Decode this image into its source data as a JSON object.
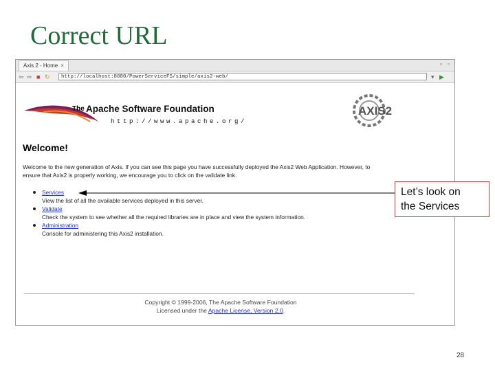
{
  "slide": {
    "title": "Correct URL",
    "page_number": "28"
  },
  "browser": {
    "tab_label": "Axis 2 - Home",
    "tab_close": "×",
    "url": "http://localhost:8080/PowerServiceFS/simple/axis2-web/",
    "icons": [
      "back-icon",
      "forward-icon",
      "stop-icon",
      "refresh-icon",
      "go-icon",
      "nav-icon"
    ]
  },
  "page": {
    "apache_the": "The",
    "apache_name": "Apache Software Foundation",
    "apache_url": "http://www.apache.org/",
    "axis_logo_text": "AXIS2",
    "welcome_heading": "Welcome!",
    "intro_line1": "Welcome to the new generation of Axis. If you can see this page you have successfully deployed the Axis2 Web Application. However, to",
    "intro_line2": "ensure that Axis2 is properly working, we encourage you to click on the validate link.",
    "links": [
      {
        "label": "Services",
        "desc": "View the list of all the available services deployed in this server."
      },
      {
        "label": "Validate",
        "desc": "Check the system to see whether all the required libraries are in place and view the system information."
      },
      {
        "label": "Administration",
        "desc": "Console for administering this Axis2 installation."
      }
    ],
    "footer_line1": "Copyright © 1999-2006, The Apache Software Foundation",
    "footer_line2_prefix": "Licensed under the ",
    "footer_license_link": "Apache License, Version 2.0",
    "footer_line2_suffix": "."
  },
  "callout": {
    "line1": "Let’s look on",
    "line2": "the Services"
  },
  "colors": {
    "title_green": "#1f6b3a",
    "link_blue": "#2233cc",
    "callout_border": "#d23b3b"
  }
}
